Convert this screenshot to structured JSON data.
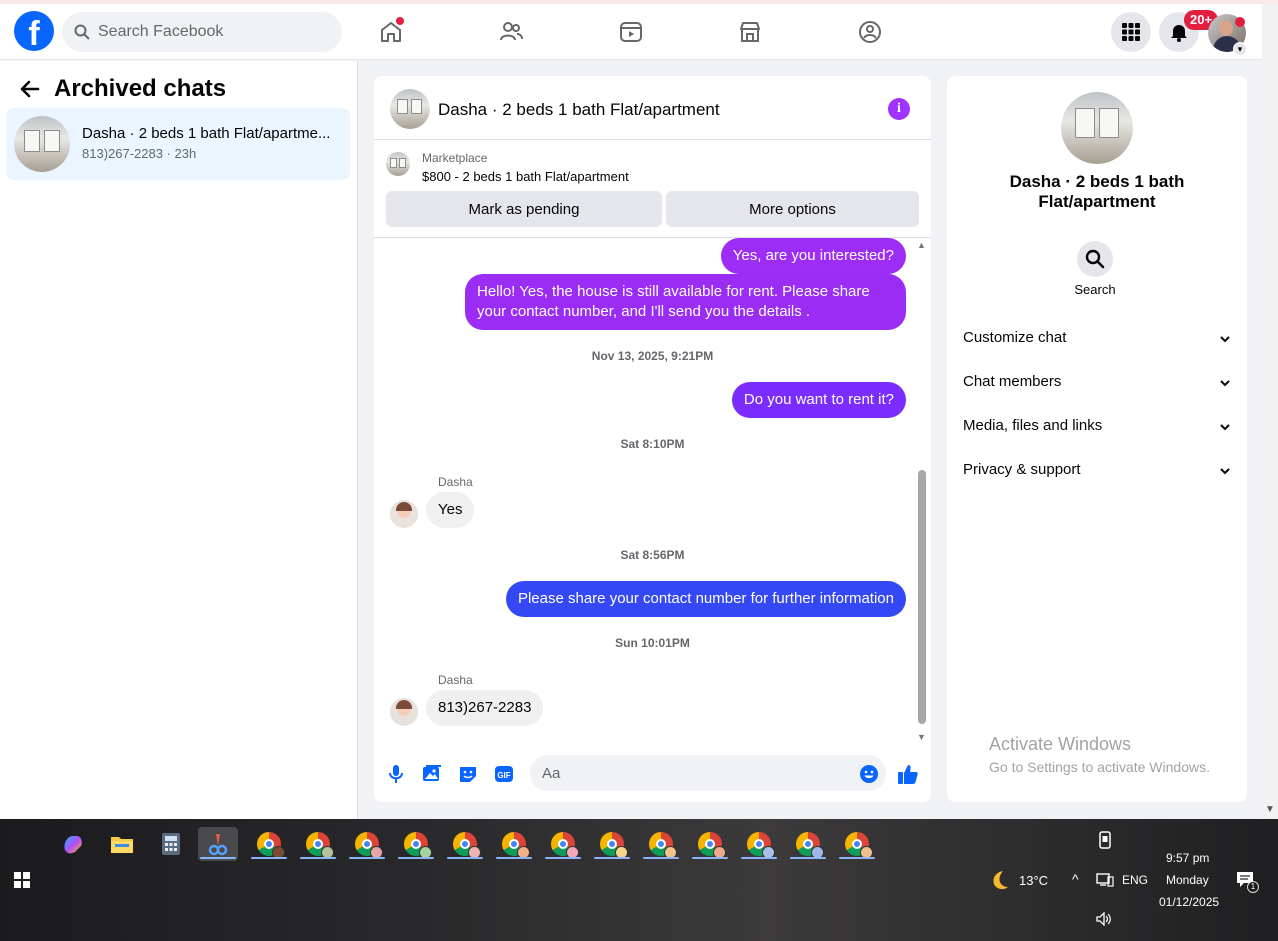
{
  "topbar": {
    "search_placeholder": "Search Facebook",
    "notification_badge": "20+",
    "nav_icons": [
      "home-icon",
      "friends-icon",
      "video-icon",
      "marketplace-icon",
      "groups-icon"
    ]
  },
  "left_panel": {
    "title": "Archived chats",
    "chats": [
      {
        "name": "Dasha · 2 beds 1 bath Flat/apartme...",
        "preview": "813)267-2283",
        "time": "23h"
      }
    ]
  },
  "chat": {
    "title": "Dasha · 2 beds 1 bath Flat/apartment",
    "marketplace": {
      "label": "Marketplace",
      "listing": "$800 - 2 beds 1 bath Flat/apartment",
      "buttons": [
        "Mark as pending",
        "More options"
      ]
    },
    "messages": [
      {
        "type": "out",
        "text": "Yes, are you interested?"
      },
      {
        "type": "out",
        "text": "Hello! Yes, the house is still available for rent. Please share your contact number, and I'll send you the details ."
      },
      {
        "type": "time",
        "text": "Nov 13, 2025, 9:21PM"
      },
      {
        "type": "out",
        "text": "Do you want to rent it?"
      },
      {
        "type": "time",
        "text": "Sat 8:10PM"
      },
      {
        "type": "in",
        "sender": "Dasha",
        "text": "Yes"
      },
      {
        "type": "time",
        "text": "Sat 8:56PM"
      },
      {
        "type": "out",
        "text": "Please share your contact number for further information"
      },
      {
        "type": "time",
        "text": "Sun 10:01PM"
      },
      {
        "type": "in",
        "sender": "Dasha",
        "text": "813)267-2283"
      }
    ],
    "composer_placeholder": "Aa"
  },
  "right_panel": {
    "name": "Dasha · 2 beds 1 bath Flat/apartment",
    "search_label": "Search",
    "sections": [
      "Customize chat",
      "Chat members",
      "Media, files and links",
      "Privacy & support"
    ],
    "watermark_title": "Activate Windows",
    "watermark_sub": "Go to Settings to activate Windows."
  },
  "taskbar": {
    "weather": "13°C",
    "language": "ENG",
    "time": "9:57 pm",
    "day": "Monday",
    "date": "01/12/2025",
    "notification_count": "1"
  },
  "colors": {
    "fb_blue": "#0866ff",
    "bubble_purple": "#a033ff",
    "bubble_violet": "#7b2cff",
    "bubble_blue": "#3448f5",
    "badge_red": "#e41e3f"
  }
}
